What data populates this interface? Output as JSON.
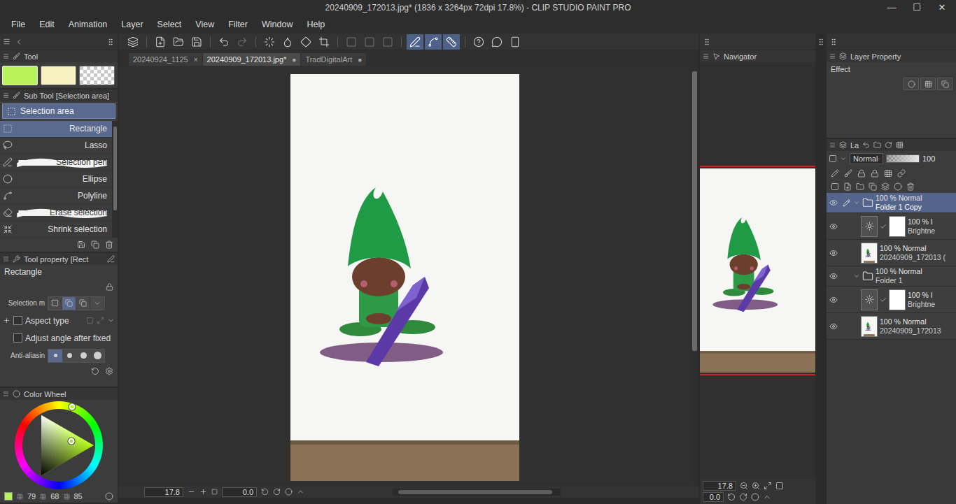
{
  "window": {
    "title": "20240909_172013.jpg* (1836 x 3264px 72dpi 17.8%)  - CLIP STUDIO PAINT PRO",
    "controls": [
      "—",
      "☐",
      "✕"
    ]
  },
  "menu": [
    "File",
    "Edit",
    "Animation",
    "Layer",
    "Select",
    "View",
    "Filter",
    "Window",
    "Help"
  ],
  "command_bar": [
    {
      "active": false,
      "disabled": false
    },
    {
      "active": false,
      "disabled": false
    },
    {
      "active": false,
      "disabled": false
    },
    {
      "active": false,
      "disabled": false
    },
    {
      "active": false,
      "disabled": false
    },
    {
      "active": false,
      "disabled": true
    },
    {
      "active": false,
      "disabled": false
    },
    {
      "active": false,
      "disabled": false
    },
    {
      "active": false,
      "disabled": false
    },
    {
      "active": false,
      "disabled": false
    },
    {
      "active": false,
      "disabled": true
    },
    {
      "active": false,
      "disabled": true
    },
    {
      "active": false,
      "disabled": true
    },
    {
      "active": true,
      "disabled": false
    },
    {
      "active": true,
      "disabled": false
    },
    {
      "active": true,
      "disabled": false
    },
    {
      "active": false,
      "disabled": false
    },
    {
      "active": false,
      "disabled": false
    },
    {
      "active": false,
      "disabled": false
    }
  ],
  "tool_panel": {
    "title": "Tool",
    "swatches": [
      {
        "kind": "solid",
        "color": "#b7f25b",
        "selected": true
      },
      {
        "kind": "solid",
        "color": "#f6f1bf",
        "selected": false
      },
      {
        "kind": "transparent",
        "color": "#ffffff",
        "selected": false
      }
    ]
  },
  "sub_tool": {
    "title": "Sub Tool [Selection area]",
    "group": "Selection area",
    "items": [
      {
        "label": "Rectangle",
        "kind": "plain",
        "selected": true
      },
      {
        "label": "Lasso",
        "kind": "plain",
        "selected": false
      },
      {
        "label": "Selection pen",
        "kind": "stroke",
        "selected": false
      },
      {
        "label": "Ellipse",
        "kind": "plain",
        "selected": false
      },
      {
        "label": "Polyline",
        "kind": "plain",
        "selected": false
      },
      {
        "label": "Erase selection",
        "kind": "stroke",
        "selected": false
      },
      {
        "label": "Shrink selection",
        "kind": "plain",
        "selected": false
      }
    ]
  },
  "tool_property": {
    "title": "Tool property [Rect",
    "name": "Rectangle",
    "rows": [
      {
        "kind": "mode",
        "label": "Selection m",
        "options": [
          {
            "selected": false
          },
          {
            "selected": true
          },
          {
            "selected": false
          }
        ]
      },
      {
        "kind": "checkbox",
        "label": "Aspect type",
        "checked": false
      },
      {
        "kind": "checkbox",
        "label": "Adjust angle after fixed",
        "checked": false
      },
      {
        "kind": "antialias",
        "label": "Anti-aliasin",
        "options": [
          {
            "selected": true
          },
          {
            "selected": false
          },
          {
            "selected": false
          },
          {
            "selected": false
          }
        ]
      }
    ]
  },
  "color_wheel": {
    "title": "Color Wheel",
    "values": [
      "79",
      "68",
      "85"
    ]
  },
  "document_tabs": [
    {
      "label": "20240924_1125",
      "mark": "×",
      "selected": false
    },
    {
      "label": "20240909_172013.jpg*",
      "mark": "●",
      "selected": true
    },
    {
      "label": "TradDigitalArt",
      "mark": "●",
      "selected": false
    }
  ],
  "canvas": {
    "zoom": "17.8",
    "angle": "0.0"
  },
  "navigator": {
    "title": "Navigator",
    "zoom": "17.8",
    "angle": "0.0"
  },
  "layer_property": {
    "title": "Layer Property",
    "section": "Effect"
  },
  "layer_panel": {
    "tab": "La",
    "blend": "Normal",
    "opacity": "100",
    "opacity_level": 1,
    "layers": [
      {
        "kind": "folder",
        "mode": "100 % Normal",
        "name": "Folder 1 Copy",
        "visible": true,
        "selected": true,
        "expanded": true,
        "mask": false
      },
      {
        "kind": "correction",
        "mode": "100 % I",
        "name": "Brightne",
        "visible": true,
        "selected": false,
        "expanded": false,
        "mask": true
      },
      {
        "kind": "raster",
        "mode": "100 % Normal",
        "name": "20240909_172013 (",
        "visible": true,
        "selected": false,
        "expanded": false,
        "mask": false
      },
      {
        "kind": "folder",
        "mode": "100 % Normal",
        "name": "Folder 1",
        "visible": true,
        "selected": false,
        "expanded": true,
        "mask": false
      },
      {
        "kind": "correction",
        "mode": "100 % I",
        "name": "Brightne",
        "visible": true,
        "selected": false,
        "expanded": false,
        "mask": true
      },
      {
        "kind": "raster",
        "mode": "100 % Normal",
        "name": "20240909_172013",
        "visible": true,
        "selected": false,
        "expanded": false,
        "mask": false
      }
    ]
  }
}
